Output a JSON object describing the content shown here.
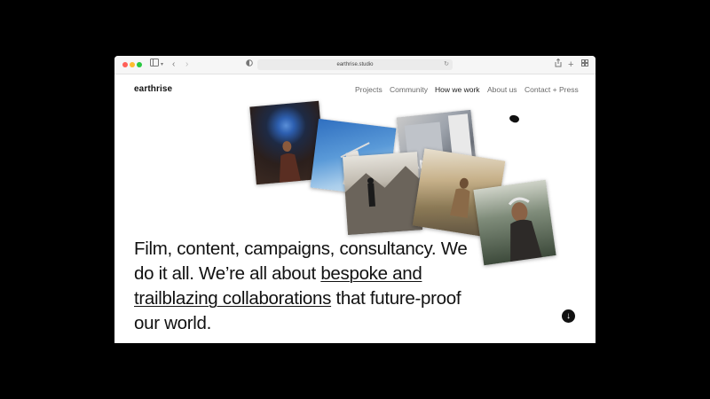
{
  "browser": {
    "url": "earthrise.studio",
    "traffic_light_colors": [
      "#ff5f57",
      "#febc2e",
      "#28c840"
    ]
  },
  "site": {
    "logo": "earthrise",
    "nav": [
      {
        "label": "Projects"
      },
      {
        "label": "Community"
      },
      {
        "label": "How we work"
      },
      {
        "label": "About us"
      },
      {
        "label": "Contact + Press"
      }
    ],
    "active_nav": "How we work"
  },
  "hero": {
    "text_1": "Film, content, campaigns, consultancy. We do it all. We’re all about ",
    "link_text": "bespoke and trailblazing collaborations",
    "text_2": " that future-proof our world."
  },
  "icons": {
    "scroll_down": "arrow-down-icon",
    "sidebar": "sidebar-icon",
    "back": "chevron-left-icon",
    "forward": "chevron-right-icon",
    "privacy": "privacy-icon",
    "reload": "reload-icon",
    "share": "share-icon",
    "new_tab": "plus-icon",
    "tabs": "tab-overview-icon"
  }
}
